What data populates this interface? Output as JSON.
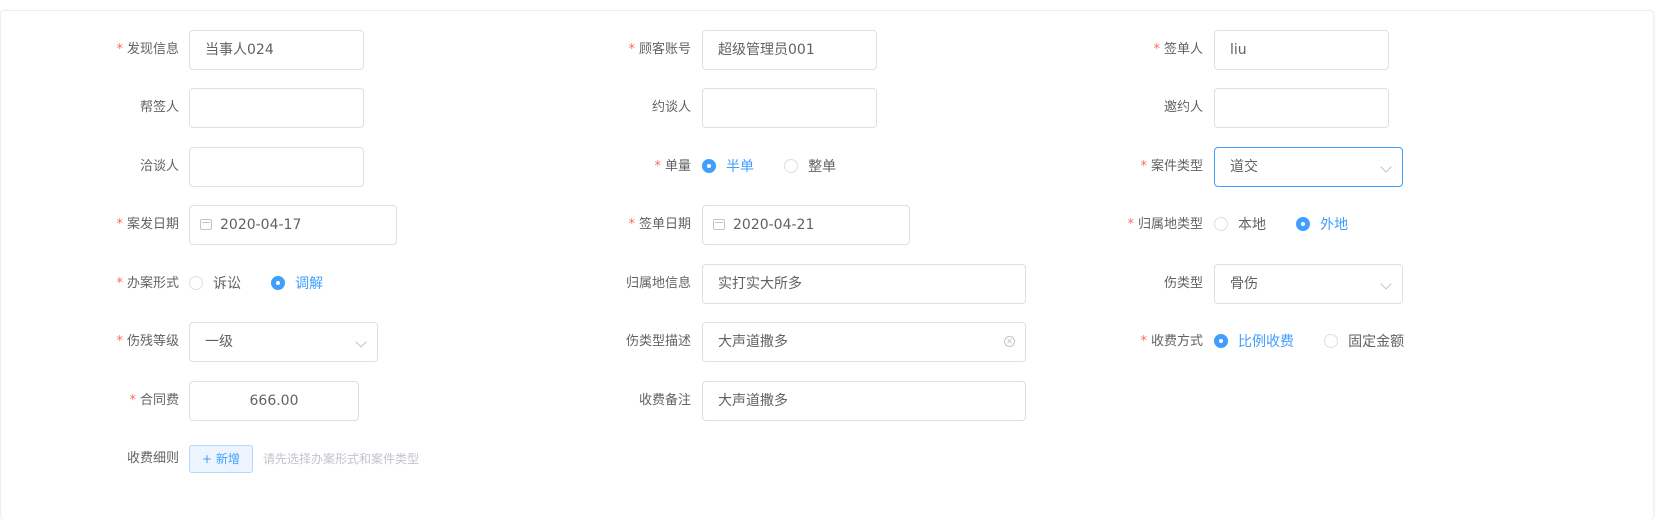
{
  "form": {
    "row1": {
      "discovery_info": {
        "label": "发现信息",
        "value": "当事人024"
      },
      "customer_account": {
        "label": "顾客账号",
        "value": "超级管理员001"
      },
      "signer": {
        "label": "签单人",
        "value": "liu"
      }
    },
    "row2": {
      "assist_signer": {
        "label": "帮签人",
        "value": ""
      },
      "interviewer": {
        "label": "约谈人",
        "value": ""
      },
      "inviter": {
        "label": "邀约人",
        "value": ""
      }
    },
    "row3": {
      "negotiator": {
        "label": "洽谈人",
        "value": ""
      },
      "order_qty": {
        "label": "单量",
        "options": [
          "半单",
          "整单"
        ],
        "selected": "半单"
      },
      "case_type": {
        "label": "案件类型",
        "value": "道交"
      }
    },
    "row4": {
      "case_date": {
        "label": "案发日期",
        "value": "2020-04-17"
      },
      "sign_date": {
        "label": "签单日期",
        "value": "2020-04-21"
      },
      "locality_type": {
        "label": "归属地类型",
        "options": [
          "本地",
          "外地"
        ],
        "selected": "外地"
      }
    },
    "row5": {
      "handling_form": {
        "label": "办案形式",
        "options": [
          "诉讼",
          "调解"
        ],
        "selected": "调解"
      },
      "locality_info": {
        "label": "归属地信息",
        "value": "实打实大所多"
      },
      "injury_type": {
        "label": "伤类型",
        "value": "骨伤"
      }
    },
    "row6": {
      "disability_level": {
        "label": "伤残等级",
        "value": "一级"
      },
      "injury_desc": {
        "label": "伤类型描述",
        "value": "大声道撒多"
      },
      "fee_method": {
        "label": "收费方式",
        "options": [
          "比例收费",
          "固定金额"
        ],
        "selected": "比例收费"
      }
    },
    "row7": {
      "contract_fee": {
        "label": "合同费",
        "value": "666.00"
      },
      "fee_note": {
        "label": "收费备注",
        "value": "大声道撒多"
      }
    },
    "row8": {
      "fee_detail": {
        "label": "收费细则",
        "add_button": "+ 新增",
        "hint": "请先选择办案形式和案件类型"
      }
    }
  },
  "colors": {
    "primary": "#409eff",
    "required": "#f56c6c",
    "border": "#dcdfe6"
  }
}
